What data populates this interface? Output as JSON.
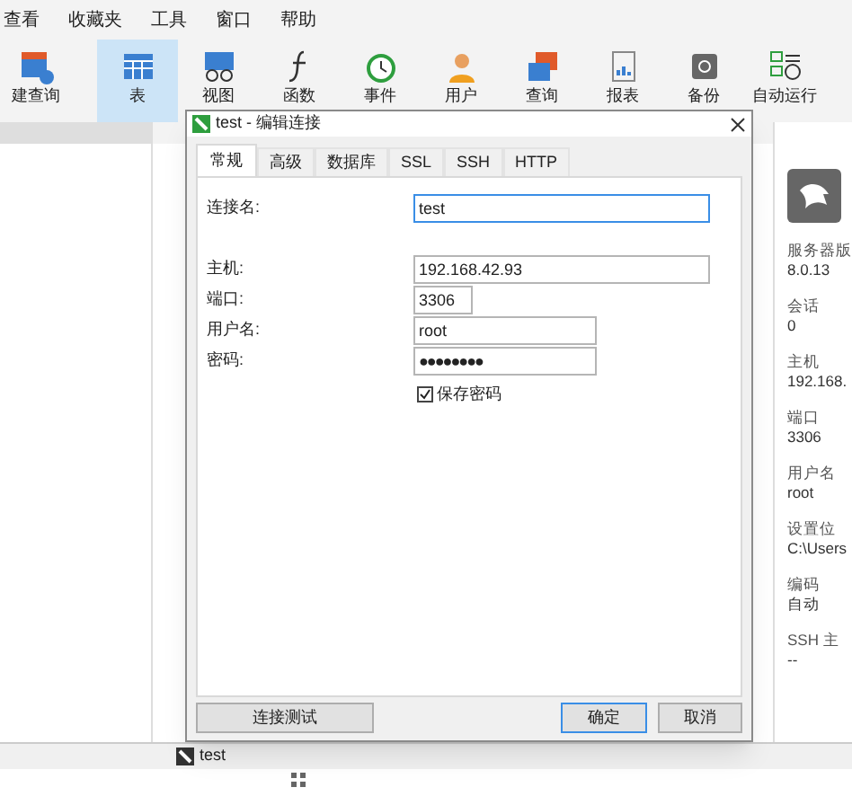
{
  "menu": [
    "查看",
    "收藏夹",
    "工具",
    "窗口",
    "帮助"
  ],
  "toolbar": [
    {
      "label": "建查询",
      "selected": false,
      "kind": "newquery"
    },
    {
      "label": "表",
      "selected": true,
      "kind": "table"
    },
    {
      "label": "视图",
      "selected": false,
      "kind": "view"
    },
    {
      "label": "函数",
      "selected": false,
      "kind": "function"
    },
    {
      "label": "事件",
      "selected": false,
      "kind": "event"
    },
    {
      "label": "用户",
      "selected": false,
      "kind": "user"
    },
    {
      "label": "查询",
      "selected": false,
      "kind": "query"
    },
    {
      "label": "报表",
      "selected": false,
      "kind": "report"
    },
    {
      "label": "备份",
      "selected": false,
      "kind": "backup"
    },
    {
      "label": "自动运行",
      "selected": false,
      "kind": "auto"
    }
  ],
  "info_panel": [
    {
      "label": "服务器版",
      "value": "8.0.13"
    },
    {
      "label": "会话",
      "value": "0"
    },
    {
      "label": "主机",
      "value": "192.168."
    },
    {
      "label": "端口",
      "value": "3306"
    },
    {
      "label": "用户名",
      "value": "root"
    },
    {
      "label": "设置位",
      "value": "C:\\Users"
    },
    {
      "label": "编码",
      "value": "自动"
    },
    {
      "label": "SSH 主",
      "value": "--"
    }
  ],
  "status_tab": "test",
  "dialog": {
    "title": "test - 编辑连接",
    "tabs": [
      {
        "label": "常规",
        "selected": true
      },
      {
        "label": "高级",
        "selected": false
      },
      {
        "label": "数据库",
        "selected": false
      },
      {
        "label": "SSL",
        "selected": false
      },
      {
        "label": "SSH",
        "selected": false
      },
      {
        "label": "HTTP",
        "selected": false
      }
    ],
    "fields": [
      {
        "label": "连接名:",
        "value": "test",
        "focused": true,
        "kind": "name"
      },
      {
        "label": "主机:",
        "value": "192.168.42.93",
        "focused": false,
        "kind": "host"
      },
      {
        "label": "端口:",
        "value": "3306",
        "focused": false,
        "kind": "port"
      },
      {
        "label": "用户名:",
        "value": "root",
        "focused": false,
        "kind": "user"
      },
      {
        "label": "密码:",
        "value": "●●●●●●●●",
        "focused": false,
        "kind": "password"
      }
    ],
    "save_password": {
      "label": "保存密码",
      "checked": true
    },
    "buttons": [
      {
        "label": "连接测试",
        "kind": "test"
      },
      {
        "label": "确定",
        "kind": "ok"
      },
      {
        "label": "取消",
        "kind": "cancel"
      }
    ]
  }
}
